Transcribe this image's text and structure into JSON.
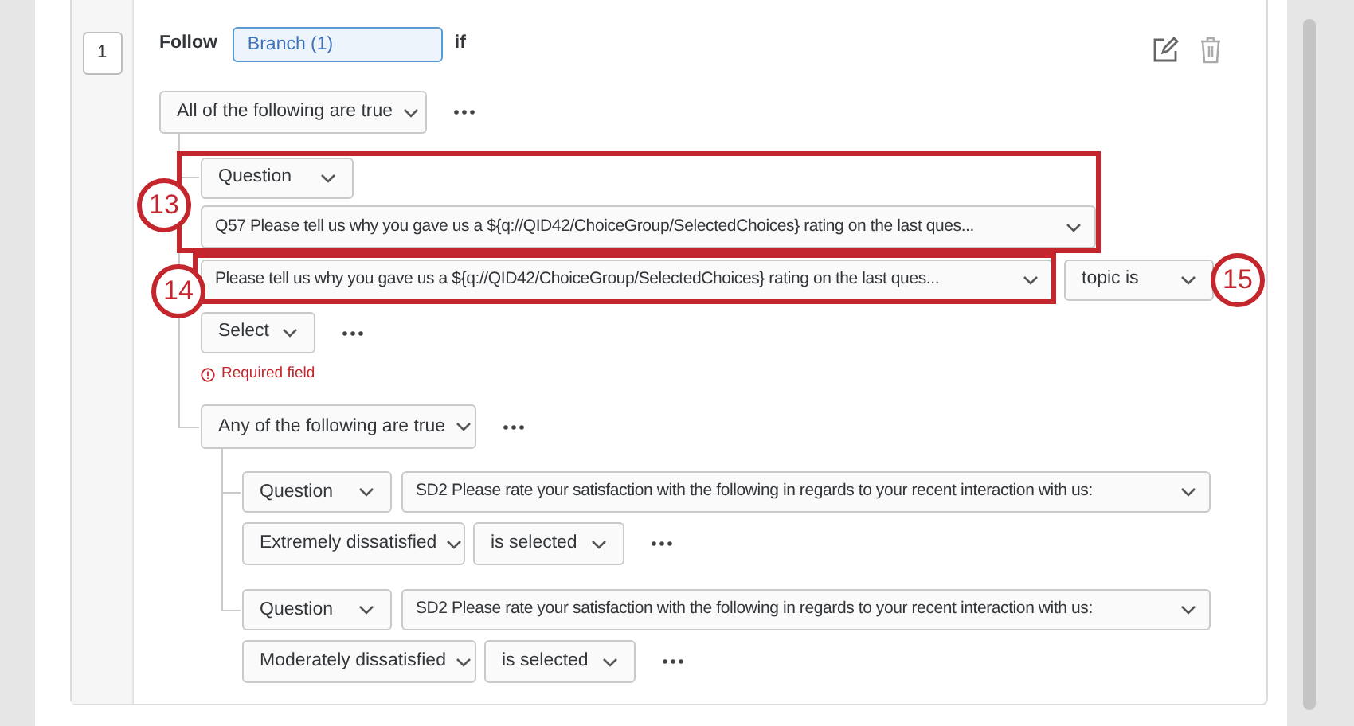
{
  "branch": {
    "number": "1",
    "label": "Follow",
    "value": "Branch (1)",
    "suffix": "if"
  },
  "conjunction": "All of the following are true",
  "condition": {
    "type": "Question",
    "question": "Q57 Please tell us why you gave us a ${q://QID42/ChoiceGroup/SelectedChoices} rating on the last ques...",
    "field": "Please tell us why you gave us a ${q://QID42/ChoiceGroup/SelectedChoices} rating on the last ques...",
    "operator": "topic is",
    "value": "Select",
    "error": "Required field"
  },
  "group": {
    "conjunction": "Any of the following are true",
    "conditions": [
      {
        "type": "Question",
        "question": "SD2 Please rate your satisfaction with the following in regards to your recent interaction with us:",
        "choice": "Extremely dissatisfied",
        "operator": "is selected"
      },
      {
        "type": "Question",
        "question": "SD2 Please rate your satisfaction with the following in regards to your recent interaction with us:",
        "choice": "Moderately dissatisfied",
        "operator": "is selected"
      }
    ]
  },
  "annotations": [
    {
      "label": "13"
    },
    {
      "label": "14"
    },
    {
      "label": "15"
    }
  ]
}
